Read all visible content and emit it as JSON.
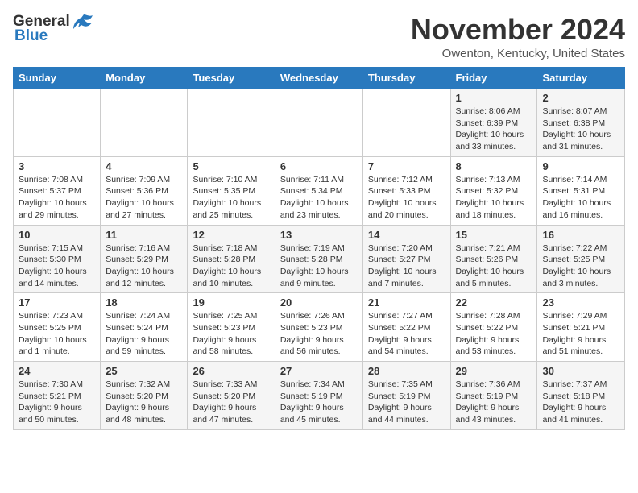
{
  "header": {
    "logo_general": "General",
    "logo_blue": "Blue",
    "month": "November 2024",
    "location": "Owenton, Kentucky, United States"
  },
  "weekdays": [
    "Sunday",
    "Monday",
    "Tuesday",
    "Wednesday",
    "Thursday",
    "Friday",
    "Saturday"
  ],
  "weeks": [
    [
      {
        "day": "",
        "info": ""
      },
      {
        "day": "",
        "info": ""
      },
      {
        "day": "",
        "info": ""
      },
      {
        "day": "",
        "info": ""
      },
      {
        "day": "",
        "info": ""
      },
      {
        "day": "1",
        "info": "Sunrise: 8:06 AM\nSunset: 6:39 PM\nDaylight: 10 hours and 33 minutes."
      },
      {
        "day": "2",
        "info": "Sunrise: 8:07 AM\nSunset: 6:38 PM\nDaylight: 10 hours and 31 minutes."
      }
    ],
    [
      {
        "day": "3",
        "info": "Sunrise: 7:08 AM\nSunset: 5:37 PM\nDaylight: 10 hours and 29 minutes."
      },
      {
        "day": "4",
        "info": "Sunrise: 7:09 AM\nSunset: 5:36 PM\nDaylight: 10 hours and 27 minutes."
      },
      {
        "day": "5",
        "info": "Sunrise: 7:10 AM\nSunset: 5:35 PM\nDaylight: 10 hours and 25 minutes."
      },
      {
        "day": "6",
        "info": "Sunrise: 7:11 AM\nSunset: 5:34 PM\nDaylight: 10 hours and 23 minutes."
      },
      {
        "day": "7",
        "info": "Sunrise: 7:12 AM\nSunset: 5:33 PM\nDaylight: 10 hours and 20 minutes."
      },
      {
        "day": "8",
        "info": "Sunrise: 7:13 AM\nSunset: 5:32 PM\nDaylight: 10 hours and 18 minutes."
      },
      {
        "day": "9",
        "info": "Sunrise: 7:14 AM\nSunset: 5:31 PM\nDaylight: 10 hours and 16 minutes."
      }
    ],
    [
      {
        "day": "10",
        "info": "Sunrise: 7:15 AM\nSunset: 5:30 PM\nDaylight: 10 hours and 14 minutes."
      },
      {
        "day": "11",
        "info": "Sunrise: 7:16 AM\nSunset: 5:29 PM\nDaylight: 10 hours and 12 minutes."
      },
      {
        "day": "12",
        "info": "Sunrise: 7:18 AM\nSunset: 5:28 PM\nDaylight: 10 hours and 10 minutes."
      },
      {
        "day": "13",
        "info": "Sunrise: 7:19 AM\nSunset: 5:28 PM\nDaylight: 10 hours and 9 minutes."
      },
      {
        "day": "14",
        "info": "Sunrise: 7:20 AM\nSunset: 5:27 PM\nDaylight: 10 hours and 7 minutes."
      },
      {
        "day": "15",
        "info": "Sunrise: 7:21 AM\nSunset: 5:26 PM\nDaylight: 10 hours and 5 minutes."
      },
      {
        "day": "16",
        "info": "Sunrise: 7:22 AM\nSunset: 5:25 PM\nDaylight: 10 hours and 3 minutes."
      }
    ],
    [
      {
        "day": "17",
        "info": "Sunrise: 7:23 AM\nSunset: 5:25 PM\nDaylight: 10 hours and 1 minute."
      },
      {
        "day": "18",
        "info": "Sunrise: 7:24 AM\nSunset: 5:24 PM\nDaylight: 9 hours and 59 minutes."
      },
      {
        "day": "19",
        "info": "Sunrise: 7:25 AM\nSunset: 5:23 PM\nDaylight: 9 hours and 58 minutes."
      },
      {
        "day": "20",
        "info": "Sunrise: 7:26 AM\nSunset: 5:23 PM\nDaylight: 9 hours and 56 minutes."
      },
      {
        "day": "21",
        "info": "Sunrise: 7:27 AM\nSunset: 5:22 PM\nDaylight: 9 hours and 54 minutes."
      },
      {
        "day": "22",
        "info": "Sunrise: 7:28 AM\nSunset: 5:22 PM\nDaylight: 9 hours and 53 minutes."
      },
      {
        "day": "23",
        "info": "Sunrise: 7:29 AM\nSunset: 5:21 PM\nDaylight: 9 hours and 51 minutes."
      }
    ],
    [
      {
        "day": "24",
        "info": "Sunrise: 7:30 AM\nSunset: 5:21 PM\nDaylight: 9 hours and 50 minutes."
      },
      {
        "day": "25",
        "info": "Sunrise: 7:32 AM\nSunset: 5:20 PM\nDaylight: 9 hours and 48 minutes."
      },
      {
        "day": "26",
        "info": "Sunrise: 7:33 AM\nSunset: 5:20 PM\nDaylight: 9 hours and 47 minutes."
      },
      {
        "day": "27",
        "info": "Sunrise: 7:34 AM\nSunset: 5:19 PM\nDaylight: 9 hours and 45 minutes."
      },
      {
        "day": "28",
        "info": "Sunrise: 7:35 AM\nSunset: 5:19 PM\nDaylight: 9 hours and 44 minutes."
      },
      {
        "day": "29",
        "info": "Sunrise: 7:36 AM\nSunset: 5:19 PM\nDaylight: 9 hours and 43 minutes."
      },
      {
        "day": "30",
        "info": "Sunrise: 7:37 AM\nSunset: 5:18 PM\nDaylight: 9 hours and 41 minutes."
      }
    ]
  ]
}
